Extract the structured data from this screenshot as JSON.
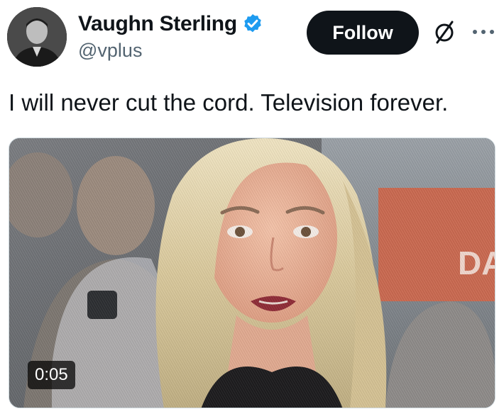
{
  "author": {
    "display_name": "Vaughn Sterling",
    "handle": "@vplus",
    "verified": true,
    "avatar_icon": "person-avatar"
  },
  "actions": {
    "follow_label": "Follow",
    "grok_icon": "grok-slash-circle-icon",
    "more_icon": "more-horizontal-icon"
  },
  "tweet": {
    "text": "I will never cut the cord. Television forever."
  },
  "media": {
    "type": "video",
    "duration": "0:05",
    "background_sign_text": "DA"
  },
  "colors": {
    "text_primary": "#0f1419",
    "text_secondary": "#536471",
    "verified_blue": "#1d9bf0",
    "follow_bg": "#0f1419"
  }
}
